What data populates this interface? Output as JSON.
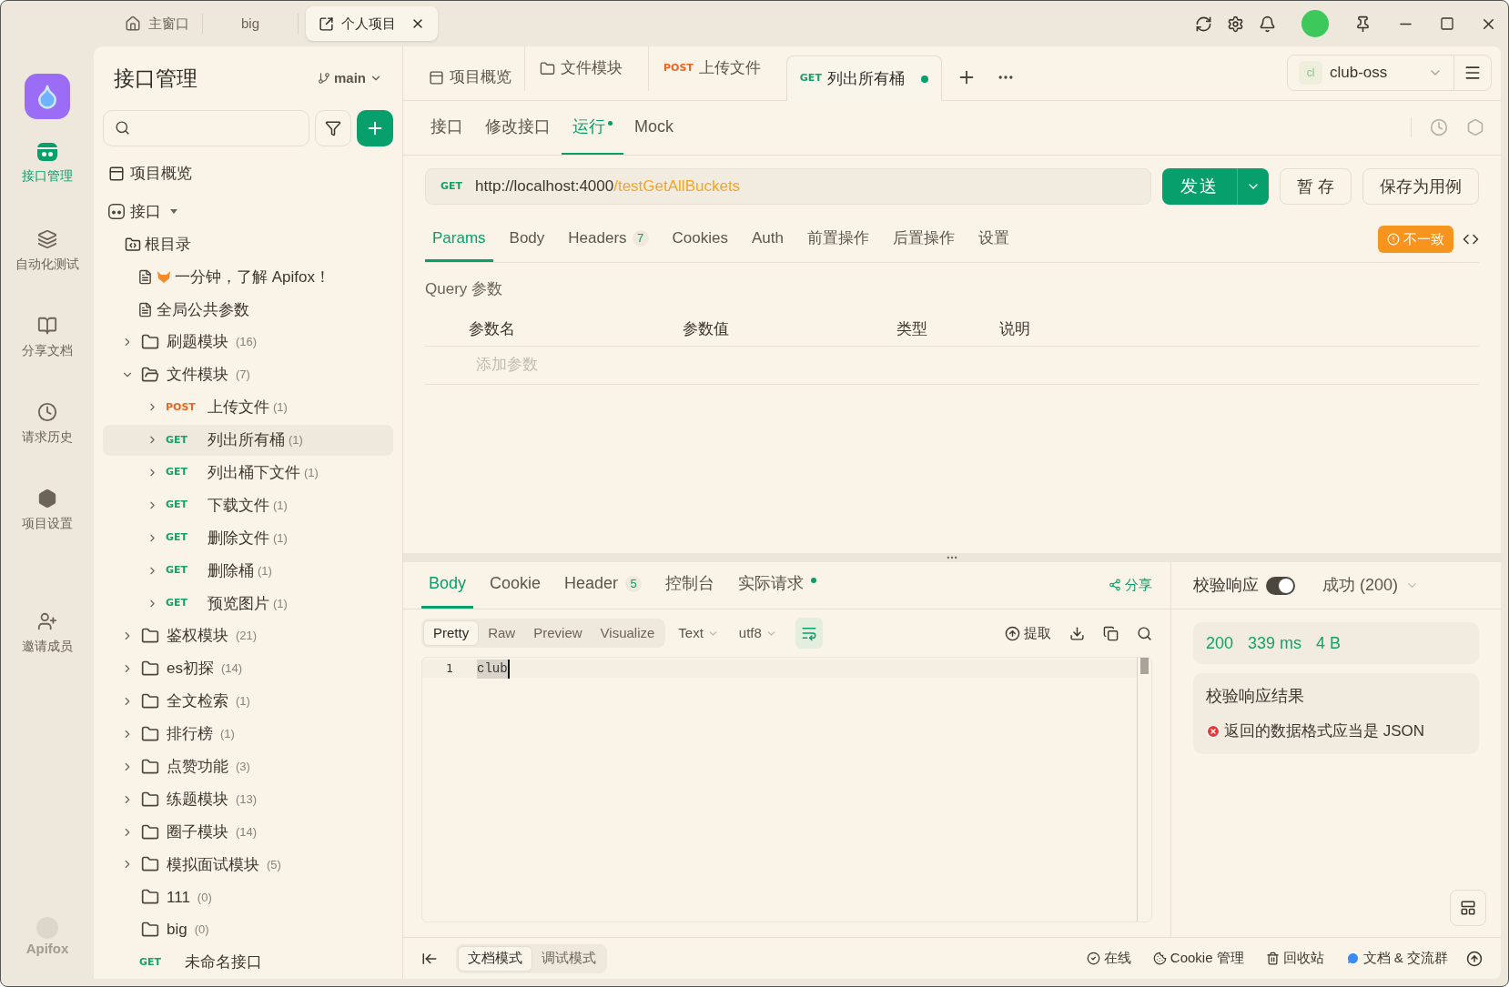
{
  "window_tabs": [
    {
      "kind": "home",
      "label": "主窗口",
      "selected": false
    },
    {
      "kind": "plain",
      "label": "big",
      "selected": false
    },
    {
      "kind": "project",
      "label": "个人项目",
      "selected": true
    }
  ],
  "nav": [
    {
      "kind": "api",
      "label": "接口管理",
      "selected": true
    },
    {
      "kind": "automation",
      "label": "自动化测试",
      "selected": false
    },
    {
      "kind": "docs",
      "label": "分享文档",
      "selected": false
    },
    {
      "kind": "history",
      "label": "请求历史",
      "selected": false
    },
    {
      "kind": "settings",
      "label": "项目设置",
      "selected": false
    },
    {
      "kind": "invite",
      "label": "邀请成员",
      "selected": false
    }
  ],
  "brand": "Apifox",
  "sidebar": {
    "title": "接口管理",
    "branch": "main",
    "overview": "项目概览",
    "api_root": "接口",
    "root_folder": "根目录",
    "tree": [
      {
        "kind": "doc",
        "emoji": true,
        "label": "一分钟，了解 Apifox！"
      },
      {
        "kind": "doc",
        "emoji": false,
        "label": "全局公共参数"
      },
      {
        "kind": "folder",
        "label": "刷题模块",
        "count": "(16)",
        "expanded": false
      },
      {
        "kind": "folder",
        "label": "文件模块",
        "count": "(7)",
        "expanded": true,
        "children": [
          {
            "kind": "request",
            "method": "POST",
            "label": "上传文件",
            "count": "(1)",
            "selected": false
          },
          {
            "kind": "request",
            "method": "GET",
            "label": "列出所有桶",
            "count": "(1)",
            "selected": true
          },
          {
            "kind": "request",
            "method": "GET",
            "label": "列出桶下文件",
            "count": "(1)",
            "selected": false
          },
          {
            "kind": "request",
            "method": "GET",
            "label": "下载文件",
            "count": "(1)",
            "selected": false
          },
          {
            "kind": "request",
            "method": "GET",
            "label": "删除文件",
            "count": "(1)",
            "selected": false
          },
          {
            "kind": "request",
            "method": "GET",
            "label": "删除桶",
            "count": "(1)",
            "selected": false
          },
          {
            "kind": "request",
            "method": "GET",
            "label": "预览图片",
            "count": "(1)",
            "selected": false
          }
        ]
      },
      {
        "kind": "folder",
        "label": "鉴权模块",
        "count": "(21)",
        "expanded": false
      },
      {
        "kind": "folder",
        "label": "es初探",
        "count": "(14)",
        "expanded": false
      },
      {
        "kind": "folder",
        "label": "全文检索",
        "count": "(1)",
        "expanded": false
      },
      {
        "kind": "folder",
        "label": "排行榜",
        "count": "(1)",
        "expanded": false
      },
      {
        "kind": "folder",
        "label": "点赞功能",
        "count": "(3)",
        "expanded": false
      },
      {
        "kind": "folder",
        "label": "练题模块",
        "count": "(13)",
        "expanded": false
      },
      {
        "kind": "folder",
        "label": "圈子模块",
        "count": "(14)",
        "expanded": false
      },
      {
        "kind": "folder",
        "label": "模拟面试模块",
        "count": "(5)",
        "expanded": false
      },
      {
        "kind": "emptyfolder",
        "label": "111",
        "count": "(0)"
      },
      {
        "kind": "emptyfolder",
        "label": "big",
        "count": "(0)"
      },
      {
        "kind": "loose",
        "method": "GET",
        "label": "未命名接口"
      }
    ]
  },
  "request_tabs": [
    {
      "kind": "overview",
      "label": "项目概览",
      "selected": false,
      "unsaved": false
    },
    {
      "kind": "folder",
      "label": "文件模块",
      "selected": false,
      "unsaved": false
    },
    {
      "kind": "request",
      "method": "POST",
      "label": "上传文件",
      "selected": false,
      "unsaved": false
    },
    {
      "kind": "request",
      "method": "GET",
      "label": "列出所有桶",
      "selected": true,
      "unsaved": true
    }
  ],
  "environment": {
    "badge": "cl",
    "name": "club-oss"
  },
  "sub_tabs": [
    {
      "label": "接口",
      "selected": false,
      "dot": false
    },
    {
      "label": "修改接口",
      "selected": false,
      "dot": false
    },
    {
      "label": "运行",
      "selected": true,
      "dot": true
    },
    {
      "label": "Mock",
      "selected": false,
      "dot": false
    }
  ],
  "url": {
    "method": "GET",
    "base": "http://localhost:4000",
    "path": "/testGetAllBuckets"
  },
  "buttons": {
    "send": "发送",
    "save": "暂 存",
    "save_case": "保存为用例"
  },
  "param_tabs": [
    {
      "label": "Params",
      "selected": true
    },
    {
      "label": "Body",
      "selected": false
    },
    {
      "label": "Headers",
      "badge": "7",
      "selected": false
    },
    {
      "label": "Cookies",
      "selected": false
    },
    {
      "label": "Auth",
      "selected": false
    },
    {
      "label": "前置操作",
      "selected": false
    },
    {
      "label": "后置操作",
      "selected": false
    },
    {
      "label": "设置",
      "selected": false
    }
  ],
  "warning": "不一致",
  "query": {
    "title": "Query 参数",
    "columns": [
      "参数名",
      "参数值",
      "类型",
      "说明"
    ],
    "placeholder": "添加参数"
  },
  "response_tabs": [
    {
      "label": "Body",
      "selected": true,
      "dot": false
    },
    {
      "label": "Cookie",
      "selected": false,
      "dot": false
    },
    {
      "label": "Header",
      "badge": "5",
      "selected": false,
      "dot": false
    },
    {
      "label": "控制台",
      "selected": false,
      "dot": false
    },
    {
      "label": "实际请求",
      "selected": false,
      "dot": true
    }
  ],
  "share": "分享",
  "view_modes": [
    {
      "label": "Pretty",
      "selected": true
    },
    {
      "label": "Raw",
      "selected": false
    },
    {
      "label": "Preview",
      "selected": false
    },
    {
      "label": "Visualize",
      "selected": false
    }
  ],
  "format": "Text",
  "encoding": "utf8",
  "wrap_on": true,
  "extract": "提取",
  "code_lines": [
    {
      "number": "1",
      "text": "club"
    }
  ],
  "validation": {
    "label": "校验响应",
    "on": true,
    "status": "成功 (200)",
    "metrics": [
      "200",
      "339 ms",
      "4 B"
    ],
    "result_title": "校验响应结果",
    "error": "返回的数据格式应当是 JSON"
  },
  "footer": {
    "modes": [
      {
        "label": "文档模式",
        "selected": true
      },
      {
        "label": "调试模式",
        "selected": false
      }
    ],
    "items": [
      {
        "kind": "online",
        "label": "在线"
      },
      {
        "kind": "cookie",
        "label": "Cookie 管理"
      },
      {
        "kind": "trash",
        "label": "回收站"
      },
      {
        "kind": "chat",
        "label": "文档 & 交流群"
      }
    ]
  }
}
